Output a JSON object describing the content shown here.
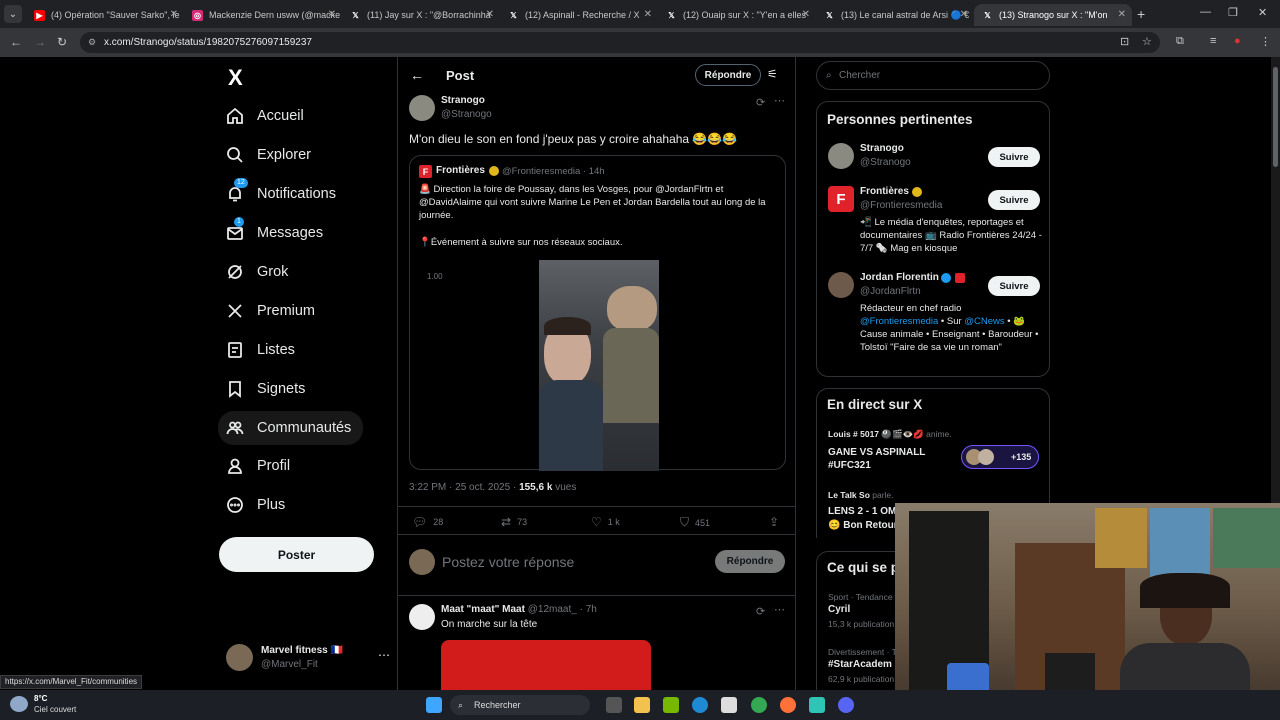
{
  "browser": {
    "tabs": [
      {
        "label": "(4) Opération \"Sauver Sarko\", le",
        "icon": "youtube-icon",
        "active": false
      },
      {
        "label": "Mackenzie Dern usww (@macke",
        "icon": "instagram-icon",
        "active": false
      },
      {
        "label": "(11) Jay sur X : \"@Borrachinha",
        "icon": "x-icon",
        "active": false
      },
      {
        "label": "(12) Aspinall - Recherche / X",
        "icon": "x-icon",
        "active": false
      },
      {
        "label": "(12) Ouaip sur X : \"Y'en a elles",
        "icon": "x-icon",
        "active": false
      },
      {
        "label": "(13) Le canal astral de Arsi 🔵 €",
        "icon": "x-icon",
        "active": false
      },
      {
        "label": "(13) Stranogo sur X : \"M'on",
        "icon": "x-icon",
        "active": true
      }
    ],
    "url": "x.com/Stranogo/status/1982075276097159237",
    "status_url": "https://x.com/Marvel_Fit/communities"
  },
  "sidebar": {
    "logo": "X",
    "items": [
      {
        "label": "Accueil",
        "icon": "home-icon"
      },
      {
        "label": "Explorer",
        "icon": "search-icon"
      },
      {
        "label": "Notifications",
        "icon": "bell-icon",
        "badge": "12"
      },
      {
        "label": "Messages",
        "icon": "mail-icon",
        "badge": "1"
      },
      {
        "label": "Grok",
        "icon": "grok-icon"
      },
      {
        "label": "Premium",
        "icon": "x-premium-icon"
      },
      {
        "label": "Listes",
        "icon": "list-icon"
      },
      {
        "label": "Signets",
        "icon": "bookmark-icon"
      },
      {
        "label": "Communautés",
        "icon": "communities-icon"
      },
      {
        "label": "Profil",
        "icon": "person-icon"
      },
      {
        "label": "Plus",
        "icon": "more-circle-icon"
      }
    ],
    "post_button": "Poster",
    "account": {
      "name": "Marvel fitness 🇫🇷",
      "handle": "@Marvel_Fit"
    }
  },
  "main": {
    "title": "Post",
    "reply_button": "Répondre",
    "post": {
      "author": "Stranogo",
      "handle": "@Stranogo",
      "text": "M'on dieu le son en fond j'peux pas y croire ahahaha 😂😂😂",
      "quote": {
        "author": "Frontières",
        "handle": "@Frontieresmedia · 14h",
        "text": "🚨 Direction la foire de Poussay, dans les Vosges, pour @JordanFlrtn et @DavidAlaime qui vont suivre Marine Le Pen et Jordan Bardella tout au long de la journée.",
        "text2": "📍Événement à suivre sur nos réseaux sociaux.",
        "video_speed": "1.00"
      },
      "meta_time": "3:22 PM · 25 oct. 2025 · ",
      "views_count": "155,6 k",
      "views_label": " vues",
      "stats": {
        "replies": "28",
        "reposts": "73",
        "likes": "1 k",
        "bookmarks": "451"
      }
    },
    "reply_placeholder": "Postez votre réponse",
    "reply_submit": "Répondre",
    "reply": {
      "author": "Maat \"maat\" Maat",
      "handle": "@12maat_ · 7h",
      "text": "On marche sur la tête"
    }
  },
  "right": {
    "search_placeholder": "Chercher",
    "relevant_title": "Personnes pertinentes",
    "people": [
      {
        "name": "Stranogo",
        "handle": "@Stranogo",
        "bio": "",
        "follow": "Suivre"
      },
      {
        "name": "Frontières",
        "handle": "@Frontieresmedia",
        "bio": "📲 Le média d'enquêtes, reportages et documentaires 📺 Radio Frontières 24/24 - 7/7 🗞️ Mag en kiosque",
        "follow": "Suivre"
      },
      {
        "name": "Jordan Florentin",
        "handle": "@JordanFlrtn",
        "bio_pre": "Rédacteur en chef radio ",
        "bio_link1": "@Frontieresmedia",
        "bio_mid": " • Sur ",
        "bio_link2": "@CNews",
        "bio_post": " • 🐸 Cause animale • Enseignant • Baroudeur • Tolstoï \"Faire de sa vie un roman\"",
        "follow": "Suivre"
      }
    ],
    "live_title": "En direct sur X",
    "live": [
      {
        "host": "Louis # 5017 🎱🎬👁️💋",
        "action": " anime.",
        "title": "GANE VS ASPINALL #UFC321",
        "count": "+135"
      },
      {
        "host": "Le Talk So",
        "action": " parle.",
        "title": "LENS 2 - 1 OM",
        "title2": "😊 Bon Retour"
      }
    ],
    "happening_title": "Ce qui se p",
    "trends": [
      {
        "cat": "Sport · Tendance",
        "name": "Cyril",
        "count": "15,3 k publication"
      },
      {
        "cat": "Divertissement · T",
        "name": "#StarAcadem",
        "count": "62,9 k publication"
      }
    ]
  },
  "taskbar": {
    "weather_temp": "8°C",
    "weather_desc": "Ciel couvert",
    "search_label": "Rechercher"
  }
}
